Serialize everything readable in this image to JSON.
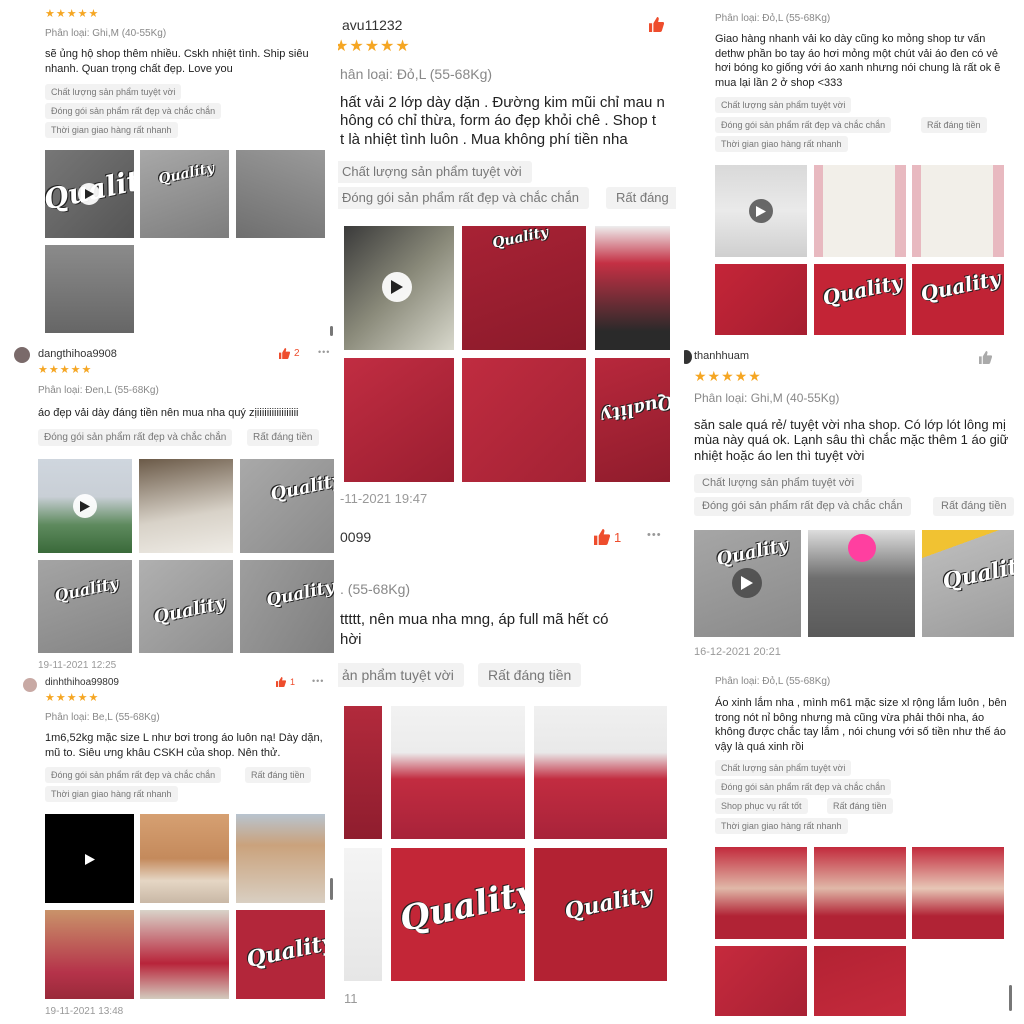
{
  "panel1": {
    "review1": {
      "stars": "★★★★★",
      "variant": "Phân loại: Ghi,M (40-55Kg)",
      "text": "sẽ ủng hộ shop thêm nhiều. Cskh nhiệt tình. Ship siêu nhanh. Quan trọng chất đẹp. Love you",
      "tags": [
        "Chất lượng sản phẩm tuyệt vời",
        "Đóng gói sản phẩm rất đẹp và chắc chắn",
        "Thời gian giao hàng rất nhanh"
      ],
      "photo_text": "Quality"
    },
    "review2": {
      "username": "dangthihoa9908",
      "likes": "2",
      "more": "•••",
      "stars": "★★★★★",
      "variant": "Phân loại: Đen,L (55-68Kg)",
      "text": "áo đẹp vải dày đáng tiền nên mua nha quý zịiiiiiiiiiiiiiiiii",
      "tags": [
        "Đóng gói sản phẩm rất đẹp và chắc chắn",
        "Rất đáng tiền"
      ],
      "date": "19-11-2021 12:25",
      "photo_text": "Quality"
    },
    "review3": {
      "username": "dinhthihoa99809",
      "likes": "1",
      "more": "•••",
      "stars": "★★★★★",
      "variant": "Phân loại: Be,L (55-68Kg)",
      "text": "1m6,52kg mặc size L như bơi trong áo luôn nạ! Dày dặn, mũ to.  Siêu ưng khâu CSKH của shop. Nên thử.",
      "tags": [
        "Đóng gói sản phẩm rất đẹp và chắc chắn",
        "Rất đáng tiền",
        "Thời gian giao hàng rất nhanh"
      ],
      "date": "19-11-2021 13:48",
      "photo_text": "Quality"
    }
  },
  "panel2": {
    "review1": {
      "username": "avu11232",
      "stars": "★★★★★",
      "variant": "hân loại: Đỏ,L (55-68Kg)",
      "text_lines": [
        "hất vải 2 lớp dày dặn . Đường kim mũi chỉ mau n",
        "hông có chỉ thừa, form áo đẹp khỏi chê . Shop t",
        "t là nhiệt tình luôn . Mua không phí tiền nha"
      ],
      "tags": [
        "Chất lượng sản phẩm tuyệt vời",
        "Đóng gói sản phẩm rất đẹp và chắc chắn",
        "Rất đáng"
      ],
      "date": "-11-2021 19:47",
      "photo_text": "Quality"
    },
    "review2": {
      "username": "0099",
      "likes": "1",
      "more": "•••",
      "variant": ". (55-68Kg)",
      "text_lines": [
        "ttttt, nên mua nha mng, áp full mã hết có",
        "hời"
      ],
      "tags": [
        "ản phẩm tuyệt vời",
        "Rất đáng tiền"
      ],
      "date": "11",
      "photo_text": "Quality"
    }
  },
  "panel3": {
    "review1": {
      "variant": "Phân loại: Đỏ,L (55-68Kg)",
      "text": "Giao hàng nhanh vải ko dày cũng ko mỏng shop tư vấn dethw phần bo tay áo hơi mỏng một chút vải áo đen có vẻ hơi bóng ko giống với áo xanh nhưng nói chung là rất ok ẽ mua lại lần 2 ở shop <333",
      "tags": [
        "Chất lượng sản phẩm tuyệt vời",
        "Đóng gói sản phẩm rất đẹp và chắc chắn",
        "Rất đáng tiền",
        "Thời gian giao hàng rất nhanh"
      ],
      "photo_text": "Quality"
    },
    "review2": {
      "username": "thanhhuam",
      "stars": "★★★★★",
      "variant": "Phân loại: Ghi,M (40-55Kg)",
      "text_lines": [
        "săn sale quá rẻ/ tuyệt vời nha shop. Có lớp lót lông mị",
        "mùa này quá ok. Lạnh sâu thì chắc mặc thêm 1 áo giữ",
        "nhiệt hoặc áo len thì tuyệt vời"
      ],
      "tags": [
        "Chất lượng sản phẩm tuyệt vời",
        "Đóng gói sản phẩm rất đẹp và chắc chắn",
        "Rất đáng tiền"
      ],
      "date": "16-12-2021 20:21",
      "photo_text": "Quality"
    },
    "review3": {
      "variant": "Phân loại: Đỏ,L (55-68Kg)",
      "text": "Áo xinh lắm nha , mình m61 mặc size xl rộng lắm luôn , bên trong nót nỉ bông nhưng mà cũng vừa phải thôi nha, áo không được chắc tay lắm , nói chung với số tiền như thế áo vậy là quá xinh rồi",
      "tags": [
        "Chất lượng sản phẩm tuyệt vời",
        "Đóng gói sản phẩm rất đẹp và chắc chắn",
        "Shop phục vụ rất tốt",
        "Rất đáng tiền",
        "Thời gian giao hàng rất nhanh"
      ]
    }
  },
  "colors": {
    "star": "#f5a623",
    "like": "#ee4d2d",
    "chip_bg": "#f2f2f2",
    "hoodie_red": "#b3263a",
    "hoodie_gray": "#8e8e8e"
  },
  "icons": [
    "play-icon",
    "thumbs-up-icon",
    "more-icon",
    "avatar-icon"
  ]
}
